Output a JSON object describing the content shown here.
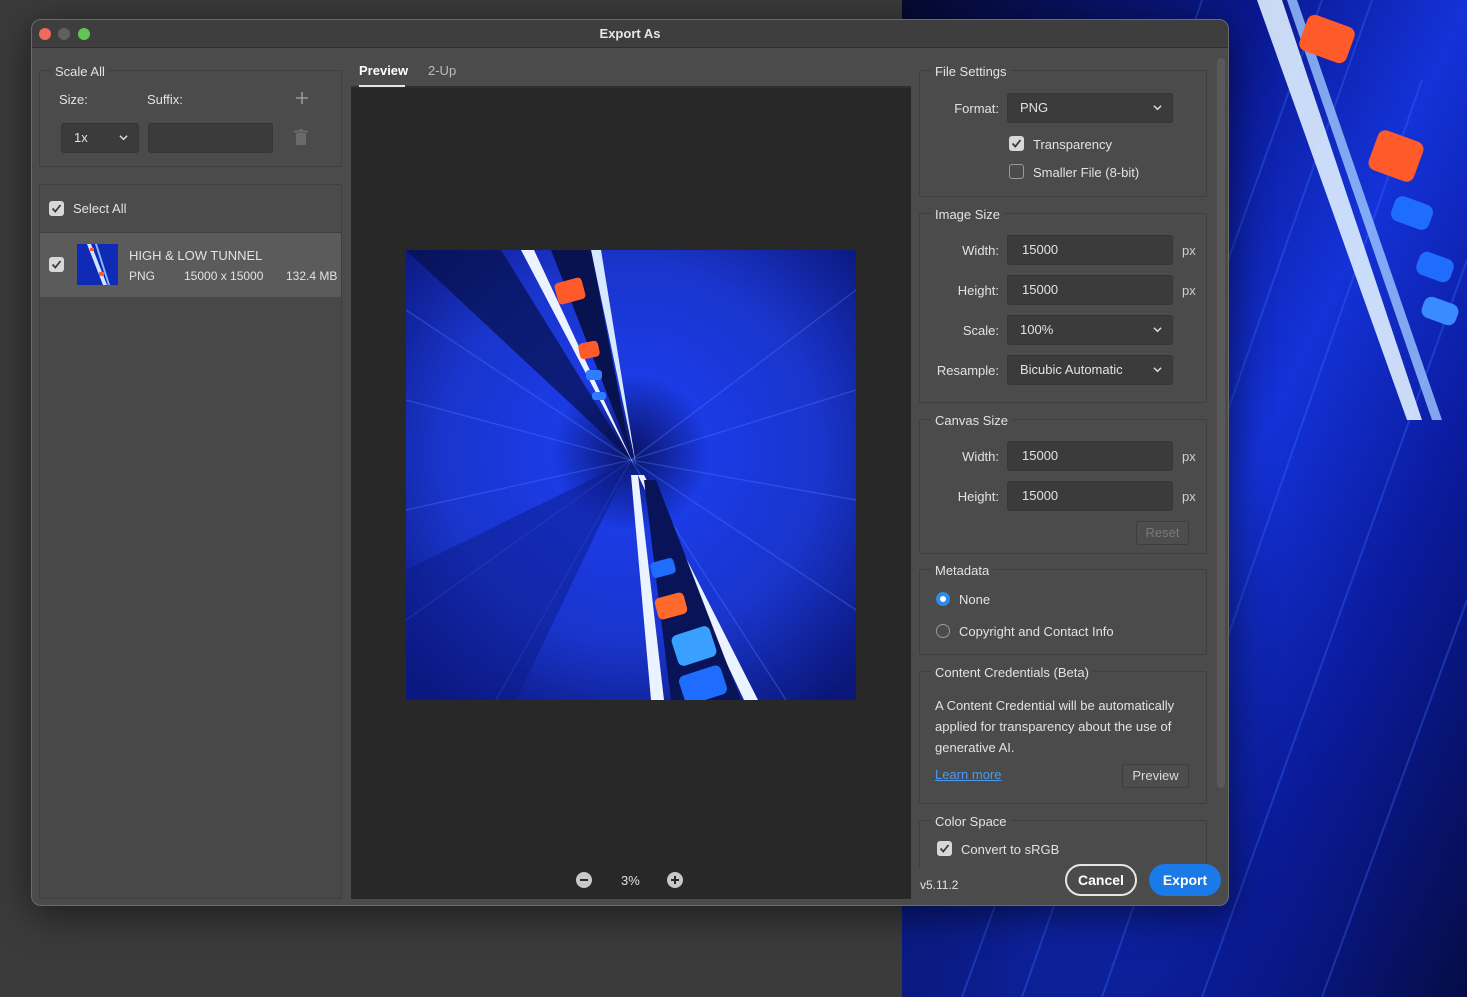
{
  "window": {
    "title": "Export As"
  },
  "scale_all": {
    "section_title": "Scale All",
    "size_label": "Size:",
    "suffix_label": "Suffix:",
    "size_value": "1x",
    "suffix_value": "",
    "add_icon": "plus-icon",
    "delete_icon": "trash-icon"
  },
  "asset_list": {
    "select_all_label": "Select All",
    "select_all_checked": true,
    "items": [
      {
        "name": "HIGH & LOW TUNNEL",
        "format": "PNG",
        "dimensions": "15000 x 15000",
        "size": "132.4 MB",
        "checked": true
      }
    ]
  },
  "preview": {
    "tabs": [
      {
        "label": "Preview",
        "active": true
      },
      {
        "label": "2-Up",
        "active": false
      }
    ],
    "zoom_level": "3%"
  },
  "file_settings": {
    "section_title": "File Settings",
    "format_label": "Format:",
    "format_value": "PNG",
    "transparency_label": "Transparency",
    "transparency_checked": true,
    "smaller_file_label": "Smaller File (8-bit)",
    "smaller_file_checked": false
  },
  "image_size": {
    "section_title": "Image Size",
    "width_label": "Width:",
    "width_value": "15000",
    "height_label": "Height:",
    "height_value": "15000",
    "unit": "px",
    "scale_label": "Scale:",
    "scale_value": "100%",
    "resample_label": "Resample:",
    "resample_value": "Bicubic Automatic"
  },
  "canvas_size": {
    "section_title": "Canvas Size",
    "width_label": "Width:",
    "width_value": "15000",
    "height_label": "Height:",
    "height_value": "15000",
    "unit": "px",
    "reset_label": "Reset"
  },
  "metadata": {
    "section_title": "Metadata",
    "options": [
      {
        "label": "None",
        "selected": true
      },
      {
        "label": "Copyright and Contact Info",
        "selected": false
      }
    ]
  },
  "content_credentials": {
    "section_title": "Content Credentials (Beta)",
    "description": "A Content Credential will be automatically applied for transparency about the use of generative AI.",
    "learn_more": "Learn more",
    "preview_button": "Preview"
  },
  "color_space": {
    "section_title": "Color Space",
    "convert_label": "Convert to sRGB",
    "convert_checked": true
  },
  "footer": {
    "version": "v5.11.2",
    "cancel_label": "Cancel",
    "export_label": "Export"
  },
  "colors": {
    "accent": "#1a7ae8",
    "radio_selected": "#2d8ceb",
    "link": "#4a9bf0"
  }
}
